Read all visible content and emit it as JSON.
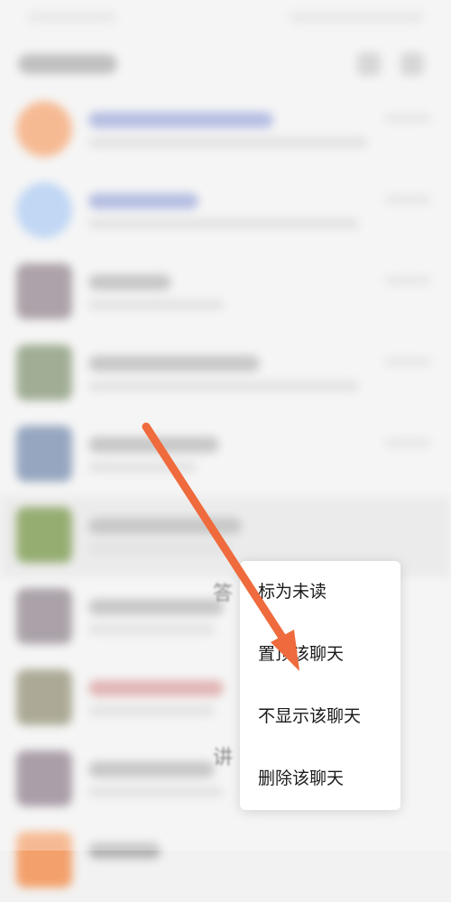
{
  "context_menu": {
    "items": [
      {
        "label": "标为未读"
      },
      {
        "label": "置顶该聊天"
      },
      {
        "label": "不显示该聊天"
      },
      {
        "label": "删除该聊天"
      }
    ]
  },
  "background_fragments": {
    "row7": "答",
    "row9": "讲"
  },
  "colors": {
    "arrow": "#ef6a3c",
    "menu_background": "#ffffff",
    "menu_text": "#1a1a1a"
  }
}
